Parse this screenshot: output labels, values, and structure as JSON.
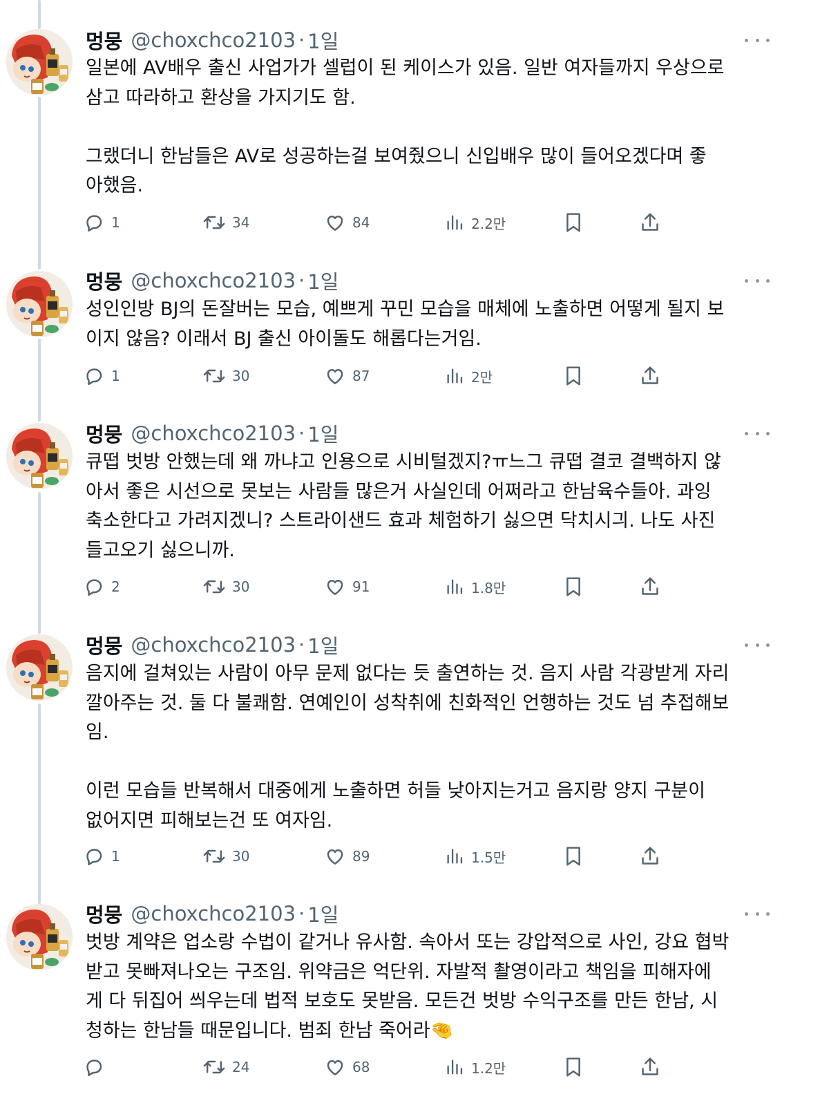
{
  "tweets": [
    {
      "author": {
        "name": "멍뭉",
        "handle": "@choxchco2103",
        "separator": "·",
        "time": "1일"
      },
      "text": "일본에 AV배우 출신 사업가가 셀럽이 된 케이스가 있음. 일반 여자들까지 우상으로\n삼고 따라하고 환상을 가지기도 함.\n\n그랬더니 한남들은 AV로 성공하는걸 보여줬으니 신입배우 많이 들어오겠다며 좋\n아했음.",
      "stats": {
        "replies": "1",
        "retweets": "34",
        "likes": "84",
        "views": "2.2만"
      }
    },
    {
      "author": {
        "name": "멍뭉",
        "handle": "@choxchco2103",
        "separator": "·",
        "time": "1일"
      },
      "text": "성인인방 BJ의 돈잘버는 모습, 예쁘게 꾸민 모습을 매체에 노출하면 어떻게 될지 보\n이지 않음? 이래서 BJ 출신 아이돌도 해롭다는거임.",
      "stats": {
        "replies": "1",
        "retweets": "30",
        "likes": "87",
        "views": "2만"
      }
    },
    {
      "author": {
        "name": "멍뭉",
        "handle": "@choxchco2103",
        "separator": "·",
        "time": "1일"
      },
      "text": "큐떱 벗방 안했는데 왜 까냐고 인용으로 시비털겠지?ㅠ느그 큐떱 결코 결백하지 않\n아서 좋은 시선으로 못보는 사람들 많은거 사실인데 어쩌라고 한남육수들아. 과잉\n축소한다고 가려지겠니? 스트라이샌드 효과 체험하기 싫으면 닥치시긔. 나도 사진\n들고오기 싫으니까.",
      "stats": {
        "replies": "2",
        "retweets": "30",
        "likes": "91",
        "views": "1.8만"
      }
    },
    {
      "author": {
        "name": "멍뭉",
        "handle": "@choxchco2103",
        "separator": "·",
        "time": "1일"
      },
      "text": "음지에 걸쳐있는 사람이 아무 문제 없다는 듯 출연하는 것. 음지 사람 각광받게 자리\n깔아주는 것. 둘 다 불쾌함. 연예인이 성착취에 친화적인 언행하는 것도 넘 추접해보\n임.\n\n이런 모습들 반복해서 대중에게 노출하면 허들 낮아지는거고 음지랑 양지 구분이\n없어지면 피해보는건 또 여자임.",
      "stats": {
        "replies": "1",
        "retweets": "30",
        "likes": "89",
        "views": "1.5만"
      }
    },
    {
      "author": {
        "name": "멍뭉",
        "handle": "@choxchco2103",
        "separator": "·",
        "time": "1일"
      },
      "text": "벗방 계약은 업소랑 수법이 같거나 유사함. 속아서 또는 강압적으로 사인, 강요 협박\n받고 못빠져나오는 구조임. 위약금은 억단위. 자발적 촬영이라고 책임을 피해자에\n게 다 뒤집어 씌우는데 법적 보호도 못받음. 모든건 벗방 수익구조를 만든 한남, 시\n청하는 한남들 때문입니다. 범죄 한남 죽어라🤏",
      "stats": {
        "replies": "",
        "retweets": "24",
        "likes": "68",
        "views": "1.2만"
      }
    }
  ],
  "icons": {
    "reply": "reply-icon",
    "retweet": "retweet-icon",
    "like": "heart-icon",
    "views": "views-icon",
    "bookmark": "bookmark-icon",
    "share": "share-icon",
    "more": "more-icon"
  },
  "colors": {
    "text": "#0f1419",
    "secondary": "#536471",
    "thread_line": "#cfd9de"
  }
}
